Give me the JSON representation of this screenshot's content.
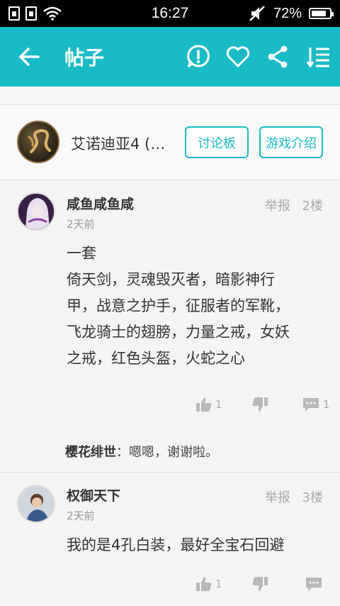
{
  "status_bar": {
    "time": "16:27",
    "battery": "72%"
  },
  "header": {
    "title": "帖子"
  },
  "game": {
    "title": "艾诺迪亚4 (…",
    "forum_button": "讨论板",
    "intro_button": "游戏介绍"
  },
  "comments": [
    {
      "user": "咸鱼咸鱼咸",
      "time": "2天前",
      "report": "举报",
      "floor": "2楼",
      "body_lines": [
        "一套",
        "倚天剑，灵魂毁灭者，暗影神行",
        "甲，战意之护手，征服者的军靴，",
        "飞龙骑士的翅膀，力量之戒，女妖",
        "之戒，红色头盔，火蛇之心"
      ],
      "likes": "1",
      "comment_count": "1",
      "reply": {
        "user": "樱花绯世",
        "sep": "：",
        "text": "嗯嗯，谢谢啦。"
      }
    },
    {
      "user": "权御天下",
      "time": "2天前",
      "report": "举报",
      "floor": "3楼",
      "body_lines": [
        "我的是4孔白装，最好全宝石回避"
      ],
      "likes": "1"
    }
  ],
  "colors": {
    "accent": "#19bbc6",
    "icon_grey": "#b8b8b8"
  }
}
